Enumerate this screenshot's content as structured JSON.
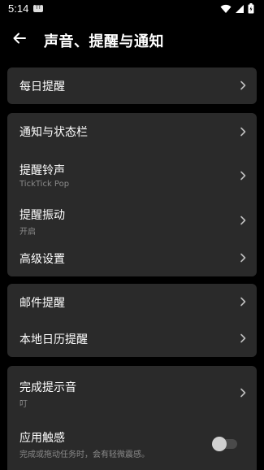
{
  "status_bar": {
    "time": "5:14",
    "badge": "TT"
  },
  "header": {
    "title": "声音、提醒与通知"
  },
  "groups": [
    {
      "items": [
        {
          "label": "每日提醒"
        }
      ]
    },
    {
      "items": [
        {
          "label": "通知与状态栏"
        },
        {
          "label": "提醒铃声",
          "subtitle": "TickTick Pop"
        },
        {
          "label": "提醒振动",
          "subtitle": "开启"
        },
        {
          "label": "高级设置"
        }
      ]
    },
    {
      "items": [
        {
          "label": "邮件提醒"
        },
        {
          "label": "本地日历提醒"
        }
      ]
    },
    {
      "items": [
        {
          "label": "完成提示音",
          "subtitle": "叮"
        },
        {
          "label": "应用触感",
          "subtitle": "完成或拖动任务时，会有轻微震感。",
          "toggle_on": false
        }
      ]
    }
  ],
  "colors": {
    "background": "#000000",
    "card": "#2a2a2a",
    "text": "#ffffff",
    "subtext": "#8a8a8a"
  }
}
